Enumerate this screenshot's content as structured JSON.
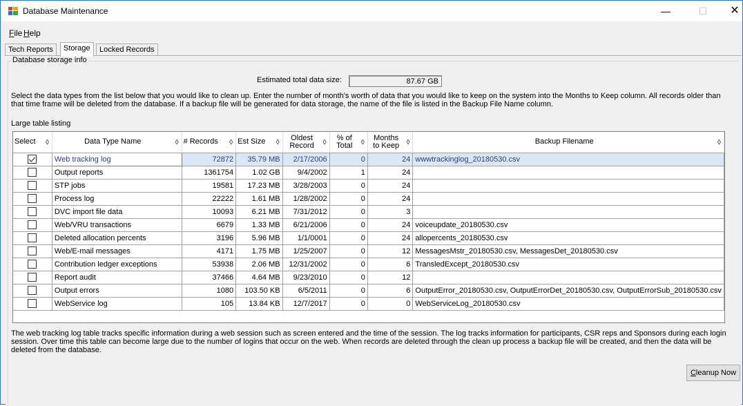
{
  "window": {
    "title": "Database Maintenance",
    "minimize": "—",
    "maximize": "☐",
    "close": "✕"
  },
  "menu": {
    "file": {
      "accel": "F",
      "rest": "ile"
    },
    "help": {
      "accel": "H",
      "rest": "elp"
    }
  },
  "tabs": [
    "Tech Reports",
    "Storage",
    "Locked Records"
  ],
  "active_tab": "Storage",
  "storage": {
    "group_title": "Database storage info",
    "estimated_label": "Estimated total data size:",
    "estimated_value": "87.67 GB",
    "instructions": "Select the data types from the list below that you would like to clean up. Enter the number of month's worth of data that you would like to keep on the system into the Months to Keep column. All records older than that time frame will be deleted from the database. If a backup file will be generated for data storage, the name of the file is listed in the Backup File Name column.",
    "large_table_label": "Large table listing",
    "columns": {
      "select": "Select",
      "name": "Data Type Name",
      "records": "# Records",
      "size": "Est Size",
      "oldest": "Oldest Record",
      "pct": "% of Total",
      "months": "Months to Keep",
      "backup": "Backup Filename"
    },
    "sort_glyph": "◊",
    "rows": [
      {
        "checked": true,
        "name": "Web tracking log",
        "records": "72872",
        "size": "35.79 MB",
        "oldest": "2/17/2006",
        "pct": "0",
        "months": "24",
        "backup": "wwwtrackinglog_20180530.csv"
      },
      {
        "checked": false,
        "name": "Output reports",
        "records": "1361754",
        "size": "1.02 GB",
        "oldest": "9/4/2002",
        "pct": "1",
        "months": "24",
        "backup": ""
      },
      {
        "checked": false,
        "name": "STP jobs",
        "records": "19581",
        "size": "17.23 MB",
        "oldest": "3/28/2003",
        "pct": "0",
        "months": "24",
        "backup": ""
      },
      {
        "checked": false,
        "name": "Process log",
        "records": "22222",
        "size": "1.61 MB",
        "oldest": "1/28/2002",
        "pct": "0",
        "months": "24",
        "backup": ""
      },
      {
        "checked": false,
        "name": "DVC import file data",
        "records": "10093",
        "size": "6.21 MB",
        "oldest": "7/31/2012",
        "pct": "0",
        "months": "3",
        "backup": ""
      },
      {
        "checked": false,
        "name": "Web/VRU transactions",
        "records": "6679",
        "size": "1.33 MB",
        "oldest": "6/21/2006",
        "pct": "0",
        "months": "24",
        "backup": "voiceupdate_20180530.csv"
      },
      {
        "checked": false,
        "name": "Deleted allocation percents",
        "records": "3196",
        "size": "5.96 MB",
        "oldest": "1/1/0001",
        "pct": "0",
        "months": "24",
        "backup": "allopercents_20180530.csv"
      },
      {
        "checked": false,
        "name": "Web/E-mail messages",
        "records": "4171",
        "size": "1.75 MB",
        "oldest": "1/25/2007",
        "pct": "0",
        "months": "12",
        "backup": "MessagesMstr_20180530.csv, MessagesDet_20180530.csv"
      },
      {
        "checked": false,
        "name": "Contribution ledger exceptions",
        "records": "53938",
        "size": "2.06 MB",
        "oldest": "12/31/2002",
        "pct": "0",
        "months": "6",
        "backup": "TransledExcept_20180530.csv"
      },
      {
        "checked": false,
        "name": "Report audit",
        "records": "37466",
        "size": "4.64 MB",
        "oldest": "9/23/2010",
        "pct": "0",
        "months": "12",
        "backup": ""
      },
      {
        "checked": false,
        "name": "Output errors",
        "records": "1080",
        "size": "103.50 KB",
        "oldest": "6/5/2011",
        "pct": "0",
        "months": "6",
        "backup": "OutputError_20180530.csv, OutputErrorDet_20180530.csv, OutputErrorSub_20180530.csv"
      },
      {
        "checked": false,
        "name": "WebService log",
        "records": "105",
        "size": "13.84 KB",
        "oldest": "12/7/2017",
        "pct": "0",
        "months": "0",
        "backup": "WebServiceLog_20180530.csv"
      }
    ],
    "description": "The web tracking log table tracks specific information during a web session such as screen entered and the time of the session.  The log tracks information for participants, CSR reps and Sponsors during each login session.  Over time this table can become large due to the number of logins that occur on the web.  When records are deleted through the clean up process a backup file will be created, and then the data will be deleted from the database.",
    "cleanup_button": {
      "accel": "C",
      "rest": "leanup Now"
    }
  }
}
